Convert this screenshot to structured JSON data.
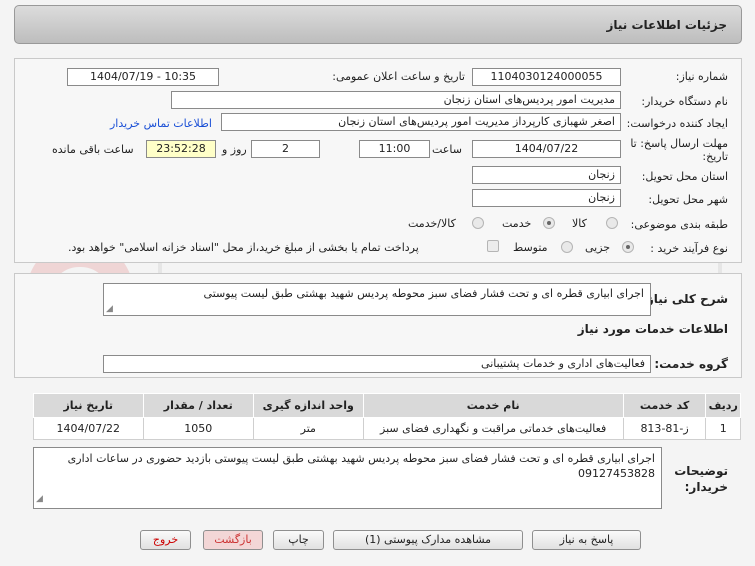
{
  "header": {
    "title": "جزئیات اطلاعات نیاز"
  },
  "form": {
    "need_number_label": "شماره نیاز:",
    "need_number": "1104030124000055",
    "announce_label": "تاریخ و ساعت اعلان عمومی:",
    "announce_value": "1404/07/19 - 10:35",
    "buyer_org_label": "نام دستگاه خریدار:",
    "buyer_org": "مدیریت امور پردیس‌های استان زنجان",
    "creator_label": "ایجاد کننده درخواست:",
    "creator": "اصغر  شهبازی  کارپرداز  مدیریت امور پردیس‌های استان زنجان",
    "contact_link": "اطلاعات تماس خریدار",
    "deadline_label": "مهلت ارسال پاسخ: تا تاریخ:",
    "deadline_date": "1404/07/22",
    "time_label": "ساعت",
    "deadline_time": "11:00",
    "days_value": "2",
    "days_label": "روز و",
    "remaining_time": "23:52:28",
    "remaining_label": "ساعت باقی مانده",
    "province_label": "استان محل تحویل:",
    "province": "زنجان",
    "city_label": "شهر محل تحویل:",
    "city": "زنجان",
    "category_label": "طبقه بندی موضوعی:",
    "category_options": [
      "کالا",
      "خدمت",
      "کالا/خدمت"
    ],
    "category_selected": "خدمت",
    "process_label": "نوع فرآیند خرید :",
    "process_options": [
      "جزیی",
      "متوسط"
    ],
    "process_selected": "جزیی",
    "payment_note": "پرداخت تمام یا بخشی از مبلغ خرید،از محل \"اسناد خزانه اسلامی\" خواهد بود."
  },
  "summary": {
    "label": "شرح کلی نیاز:",
    "text": "اجرای ابیاری قطره ای و تحت فشار فضای سبز محوطه پردیس شهید بهشتی طبق لیست پیوستی"
  },
  "services": {
    "title": "اطلاعات خدمات مورد نیاز",
    "group_label": "گروه خدمت:",
    "group_value": "فعالیت‌های اداری و خدمات پشتیبانی",
    "columns": [
      "ردیف",
      "کد خدمت",
      "نام خدمت",
      "واحد اندازه گیری",
      "تعداد / مقدار",
      "تاریخ نیاز"
    ],
    "rows": [
      [
        "1",
        "ز-81-813",
        "فعالیت‌های خدماتی مراقبت و نگهداری فضای سبز",
        "متر",
        "1050",
        "1404/07/22"
      ]
    ]
  },
  "notes": {
    "label": "توضیحات خریدار:",
    "text": "اجرای ابیاری قطره ای و تحت فشار فضای سبز محوطه پردیس شهید بهشتی طبق لیست پیوستی بازدید حضوری در ساعات اداری 09127453828"
  },
  "buttons": {
    "reply": "پاسخ به نیاز",
    "attachments": "مشاهده مدارک پیوستی (1)",
    "print": "چاپ",
    "back": "بازگشت",
    "exit": "خروج"
  },
  "colors": {
    "link": "#1a4fd6",
    "exit_text": "#cc0000",
    "back_bg": "#f3d6d6"
  }
}
